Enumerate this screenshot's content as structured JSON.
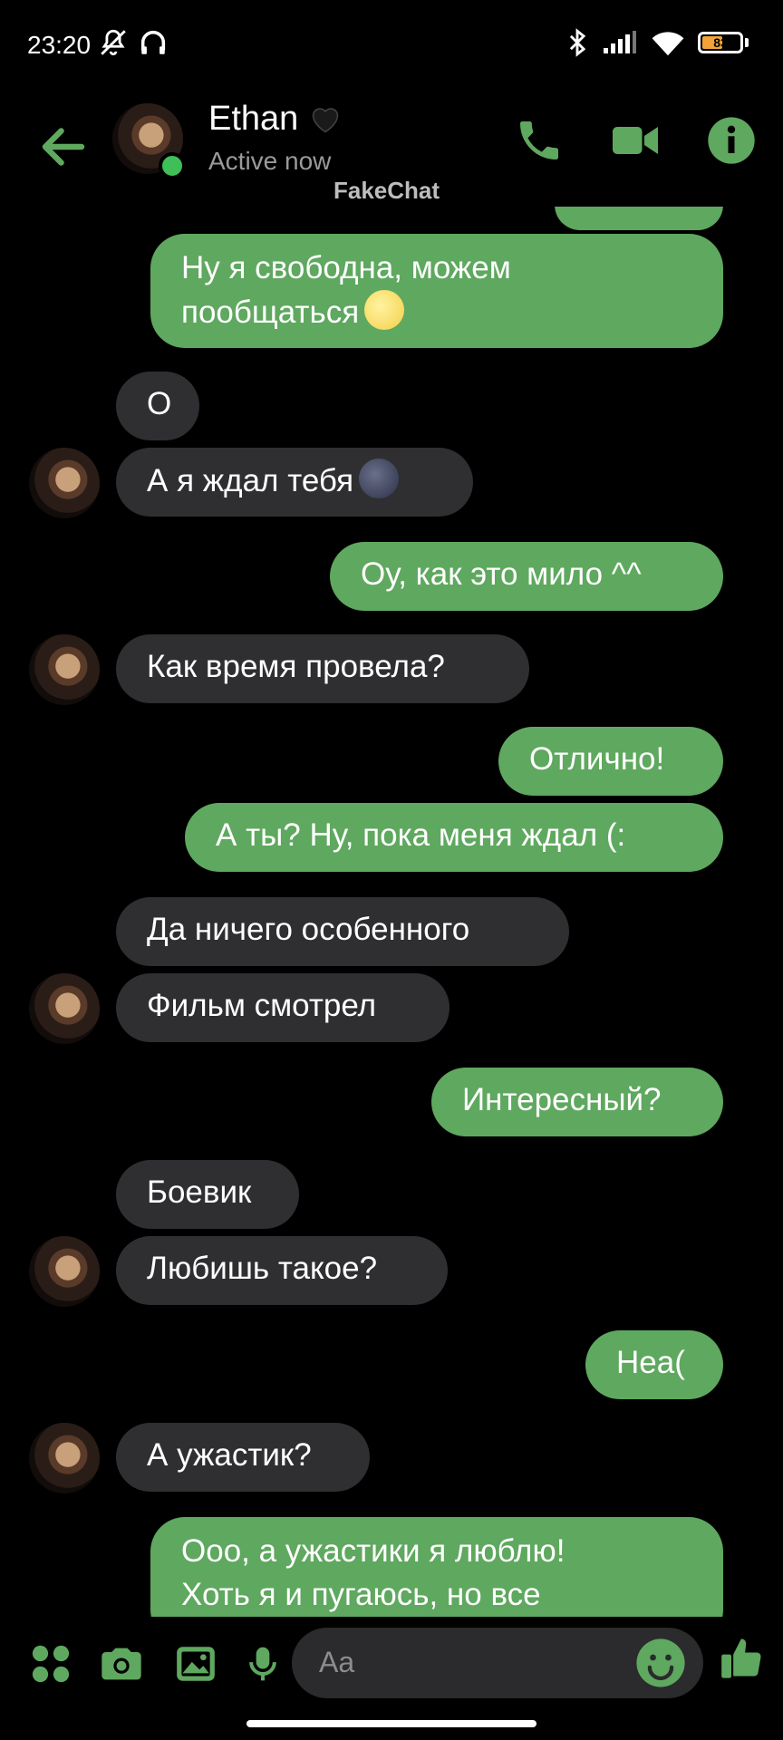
{
  "status_bar": {
    "time": "23:20",
    "battery": "83"
  },
  "header": {
    "contact_name": "Ethan",
    "contact_status": "Active now",
    "watermark": "FakeChat"
  },
  "colors": {
    "accent": "#5fa85f",
    "incoming": "#2f2f31",
    "background": "#000000"
  },
  "messages": [
    {
      "dir": "out",
      "text": "Ну я свободна, можем"
    },
    {
      "dir": "out",
      "text": "пообщаться"
    },
    {
      "dir": "in",
      "text": "О"
    },
    {
      "dir": "in",
      "text": "А я ждал тебя"
    },
    {
      "dir": "out",
      "text": "Оу, как это мило ^^"
    },
    {
      "dir": "in",
      "text": "Как время провела?"
    },
    {
      "dir": "out",
      "text": "Отлично!"
    },
    {
      "dir": "out",
      "text": "А ты? Ну, пока меня ждал (:"
    },
    {
      "dir": "in",
      "text": "Да ничего особенного"
    },
    {
      "dir": "in",
      "text": "Фильм смотрел"
    },
    {
      "dir": "out",
      "text": "Интересный?"
    },
    {
      "dir": "in",
      "text": "Боевик"
    },
    {
      "dir": "in",
      "text": "Любишь такое?"
    },
    {
      "dir": "out",
      "text": "Неа("
    },
    {
      "dir": "in",
      "text": "А ужастик?"
    },
    {
      "dir": "out",
      "text": "Ооо, а ужастики я люблю!"
    },
    {
      "dir": "out",
      "text": "Хоть я и пугаюсь, но все"
    }
  ],
  "composer": {
    "placeholder": "Aa"
  },
  "icons": [
    "back-arrow-icon",
    "phone-icon",
    "video-icon",
    "info-icon",
    "apps-icon",
    "camera-icon",
    "gallery-icon",
    "mic-icon",
    "emoji-icon",
    "thumbs-up-icon"
  ]
}
